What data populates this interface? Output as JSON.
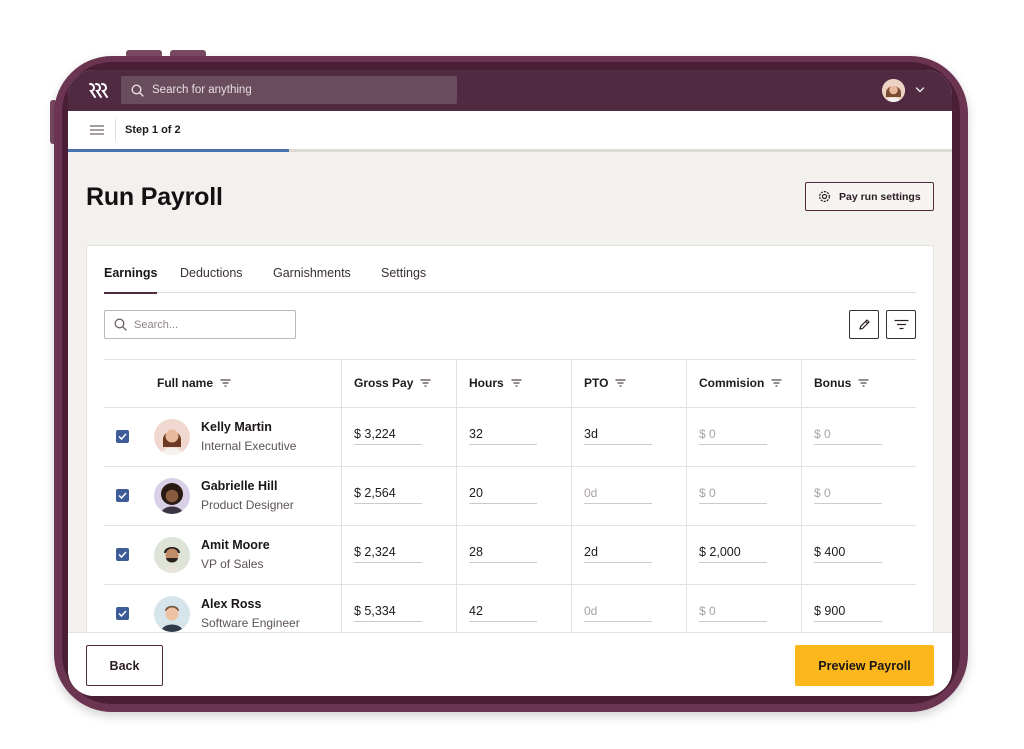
{
  "app": {
    "search_placeholder": "Search for anything",
    "step_label": "Step 1 of 2",
    "progress": 0.25
  },
  "page": {
    "title": "Run Payroll",
    "settings_button": "Pay run settings"
  },
  "tabs": [
    {
      "label": "Earnings",
      "active": true
    },
    {
      "label": "Deductions",
      "active": false
    },
    {
      "label": "Garnishments",
      "active": false
    },
    {
      "label": "Settings",
      "active": false
    }
  ],
  "table": {
    "search_placeholder": "Search...",
    "columns": [
      "Full name",
      "Gross Pay",
      "Hours",
      "PTO",
      "Commision",
      "Bonus"
    ],
    "rows": [
      {
        "name": "Kelly Martin",
        "role": "Internal Executive",
        "gross_pay": "$ 3,224",
        "hours": "32",
        "pto": "3d",
        "commission": "$ 0",
        "bonus": "$ 0",
        "checked": true
      },
      {
        "name": "Gabrielle Hill",
        "role": "Product Designer",
        "gross_pay": "$ 2,564",
        "hours": "20",
        "pto": "0d",
        "commission": "$ 0",
        "bonus": "$ 0",
        "checked": true
      },
      {
        "name": "Amit Moore",
        "role": "VP of Sales",
        "gross_pay": "$ 2,324",
        "hours": "28",
        "pto": "2d",
        "commission": "$ 2,000",
        "bonus": "$ 400",
        "checked": true
      },
      {
        "name": "Alex Ross",
        "role": "Software Engineer",
        "gross_pay": "$ 5,334",
        "hours": "42",
        "pto": "0d",
        "commission": "$ 0",
        "bonus": "$ 900",
        "checked": true
      }
    ]
  },
  "footer": {
    "back_label": "Back",
    "preview_label": "Preview Payroll"
  },
  "colors": {
    "brand_plum": "#4f2a40",
    "accent_yellow": "#fbb71c",
    "checkbox_blue": "#3e5c97",
    "progress_blue": "#4a72b0"
  }
}
